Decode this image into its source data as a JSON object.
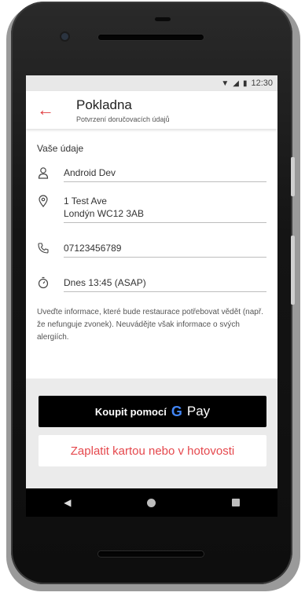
{
  "status": {
    "time": "12:30",
    "wifi_icon": "wifi-icon",
    "signal_icon": "signal-icon",
    "battery_icon": "battery-icon"
  },
  "appbar": {
    "title": "Pokladna",
    "subtitle": "Potvrzení doručovacích údajů"
  },
  "details": {
    "section_title": "Vaše údaje",
    "name": "Android Dev",
    "address_line1": "1 Test Ave",
    "address_line2": "Londýn WC12 3AB",
    "phone": "07123456789",
    "time": "Dnes 13:45 (ASAP)"
  },
  "hint": "Uveďte informace, které bude restaurace potřebovat vědět (např. že nefunguje zvonek). Neuvádějte však informace o svých alergiích.",
  "buttons": {
    "gpay_label": "Koupit pomocí",
    "gpay_g": "G",
    "gpay_pay": "Pay",
    "card_label": "Zaplatit kartou nebo v hotovosti"
  },
  "colors": {
    "accent": "#e03a3e",
    "gpay_background": "#000000"
  }
}
